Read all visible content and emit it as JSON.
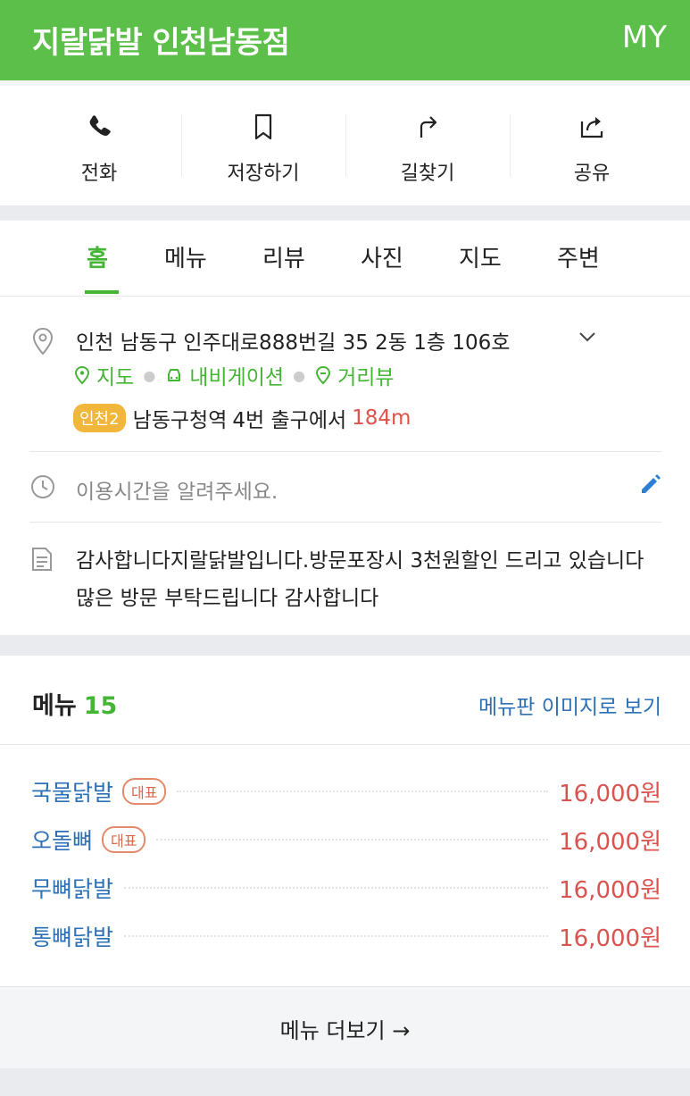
{
  "header": {
    "title": "지랄닭발 인천남동점",
    "my": "MY"
  },
  "actions": [
    {
      "label": "전화",
      "icon": "phone-icon"
    },
    {
      "label": "저장하기",
      "icon": "bookmark-icon"
    },
    {
      "label": "길찾기",
      "icon": "directions-icon"
    },
    {
      "label": "공유",
      "icon": "share-icon"
    }
  ],
  "tabs": [
    "홈",
    "메뉴",
    "리뷰",
    "사진",
    "지도",
    "주변"
  ],
  "active_tab": "홈",
  "info": {
    "address": "인천 남동구 인주대로888번길 35 2동 1층 106호",
    "links": [
      "지도",
      "내비게이션",
      "거리뷰"
    ],
    "subway_line": "인천2",
    "station": "남동구청역",
    "exit_text": "4번 출구에서",
    "distance": "184m",
    "hours_placeholder": "이용시간을 알려주세요.",
    "description": "감사합니다지랄닭발입니다.방문포장시 3천원할인 드리고 있습니다 많은 방문 부탁드립니다 감사합니다"
  },
  "menu": {
    "title": "메뉴",
    "count": "15",
    "image_link": "메뉴판 이미지로 보기",
    "items": [
      {
        "name": "국물닭발",
        "badge": "대표",
        "price": "16,000원"
      },
      {
        "name": "오돌뼈",
        "badge": "대표",
        "price": "16,000원"
      },
      {
        "name": "무뼈닭발",
        "badge": "",
        "price": "16,000원"
      },
      {
        "name": "통뼈닭발",
        "badge": "",
        "price": "16,000원"
      }
    ],
    "more_label": "메뉴 더보기 →"
  },
  "colors": {
    "brand": "#5cbf4a",
    "link": "#2c70b5",
    "price": "#d9534f",
    "subway": "#f1b63c"
  }
}
